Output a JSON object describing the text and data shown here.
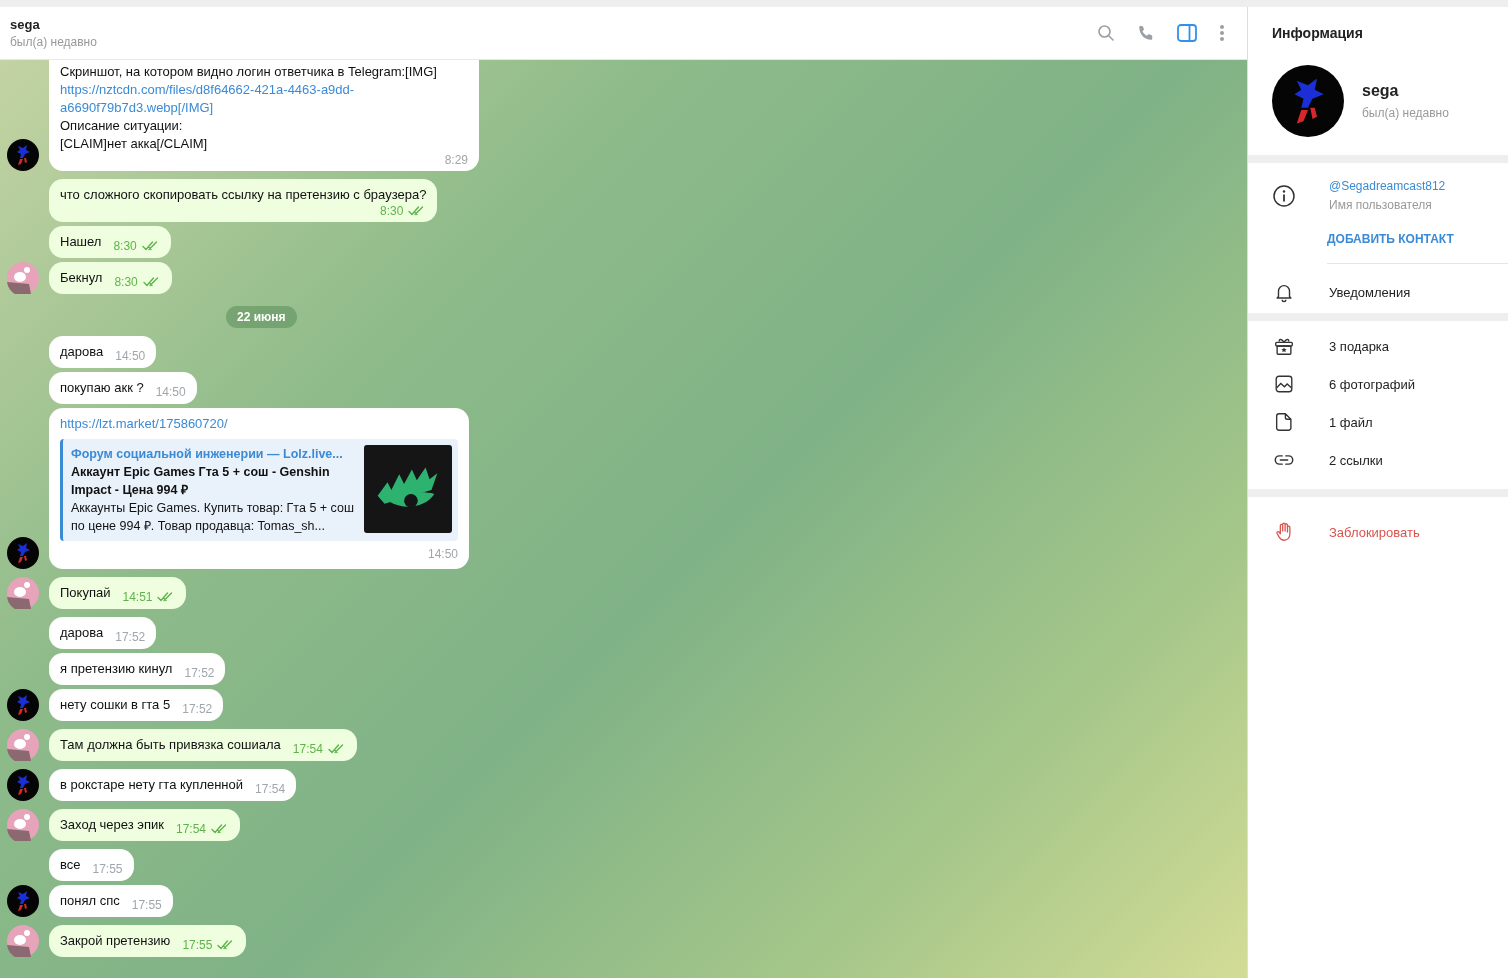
{
  "header": {
    "name": "sega",
    "status": "был(а) недавно",
    "info_panel_on": true
  },
  "messages": [
    {
      "kind": "message",
      "outgoing": false,
      "avatar": true,
      "cut_top": true,
      "parts": [
        {
          "kind": "text",
          "text": "Скриншот, на котором видно логин ответчика в Telegram:[IMG]"
        },
        {
          "kind": "link",
          "text": "https://nztcdn.com/files/d8f64662-421a-4463-a9dd-"
        },
        {
          "kind": "link",
          "text": "a6690f79b7d3.webp[/IMG]"
        },
        {
          "kind": "text",
          "text": "Описание ситуации:"
        },
        {
          "kind": "text",
          "text": "[CLAIM]нет акка[/CLAIM]"
        }
      ],
      "time": "8:29",
      "time_below": true
    },
    {
      "kind": "message",
      "outgoing": true,
      "avatar": false,
      "read": true,
      "parts": [
        {
          "kind": "text",
          "text": "что сложного скопировать ссылку на претензию с браузера?"
        }
      ],
      "time": "8:30",
      "time_below": true
    },
    {
      "kind": "message",
      "outgoing": true,
      "avatar": false,
      "read": true,
      "parts": [
        {
          "kind": "text",
          "text": "Нашел"
        }
      ],
      "time": "8:30"
    },
    {
      "kind": "message",
      "outgoing": true,
      "avatar": true,
      "read": true,
      "parts": [
        {
          "kind": "text",
          "text": "Бекнул"
        }
      ],
      "time": "8:30"
    },
    {
      "kind": "date",
      "text": "22 июня"
    },
    {
      "kind": "message",
      "outgoing": false,
      "avatar": false,
      "parts": [
        {
          "kind": "text",
          "text": "дарова"
        }
      ],
      "time": "14:50"
    },
    {
      "kind": "message",
      "outgoing": false,
      "avatar": false,
      "parts": [
        {
          "kind": "text",
          "text": "покупаю акк ?"
        }
      ],
      "time": "14:50"
    },
    {
      "kind": "preview",
      "outgoing": false,
      "avatar": true,
      "link": "https://lzt.market/175860720/",
      "site": "Форум социальной инженерии —  Lolz.live...",
      "title": "Аккаунт Epic Games Гта 5 + сош - Genshin Impact - Цена 994 ₽",
      "description": "Аккаунты Epic Games. Купить товар: Гта 5 + сош по цене 994 ₽. Товар продавца: Tomas_sh...",
      "time": "14:50"
    },
    {
      "kind": "message",
      "outgoing": true,
      "avatar": true,
      "read": true,
      "parts": [
        {
          "kind": "text",
          "text": "Покупай"
        }
      ],
      "time": "14:51"
    },
    {
      "kind": "message",
      "outgoing": false,
      "avatar": false,
      "parts": [
        {
          "kind": "text",
          "text": "дарова"
        }
      ],
      "time": "17:52"
    },
    {
      "kind": "message",
      "outgoing": false,
      "avatar": false,
      "parts": [
        {
          "kind": "text",
          "text": "я претензию кинул"
        }
      ],
      "time": "17:52"
    },
    {
      "kind": "message",
      "outgoing": false,
      "avatar": true,
      "parts": [
        {
          "kind": "text",
          "text": "нету сошки в гта 5"
        }
      ],
      "time": "17:52"
    },
    {
      "kind": "message",
      "outgoing": true,
      "avatar": true,
      "read": true,
      "parts": [
        {
          "kind": "text",
          "text": "Там должна быть привязка сошиала"
        }
      ],
      "time": "17:54"
    },
    {
      "kind": "message",
      "outgoing": false,
      "avatar": true,
      "parts": [
        {
          "kind": "text",
          "text": "в рокстаре нету гта купленной"
        }
      ],
      "time": "17:54"
    },
    {
      "kind": "message",
      "outgoing": true,
      "avatar": true,
      "read": true,
      "parts": [
        {
          "kind": "text",
          "text": "Заход через эпик"
        }
      ],
      "time": "17:54"
    },
    {
      "kind": "message",
      "outgoing": false,
      "avatar": false,
      "parts": [
        {
          "kind": "text",
          "text": "все"
        }
      ],
      "time": "17:55"
    },
    {
      "kind": "message",
      "outgoing": false,
      "avatar": true,
      "parts": [
        {
          "kind": "text",
          "text": "понял спс"
        }
      ],
      "time": "17:55"
    },
    {
      "kind": "message",
      "outgoing": true,
      "avatar": true,
      "read": true,
      "parts": [
        {
          "kind": "text",
          "text": "Закрой претензию"
        }
      ],
      "time": "17:55"
    }
  ],
  "info": {
    "title": "Информация",
    "name": "sega",
    "status": "был(а) недавно",
    "username": "@Segadreamcast812",
    "username_label": "Имя пользователя",
    "add_contact": "ДОБАВИТЬ КОНТАКТ",
    "notifications": "Уведомления",
    "media": [
      {
        "kind": "gift",
        "label": "3 подарка"
      },
      {
        "kind": "photo",
        "label": "6 фотографий"
      },
      {
        "kind": "file",
        "label": "1 файл"
      },
      {
        "kind": "link",
        "label": "2 ссылки"
      }
    ],
    "block": "Заблокировать"
  }
}
